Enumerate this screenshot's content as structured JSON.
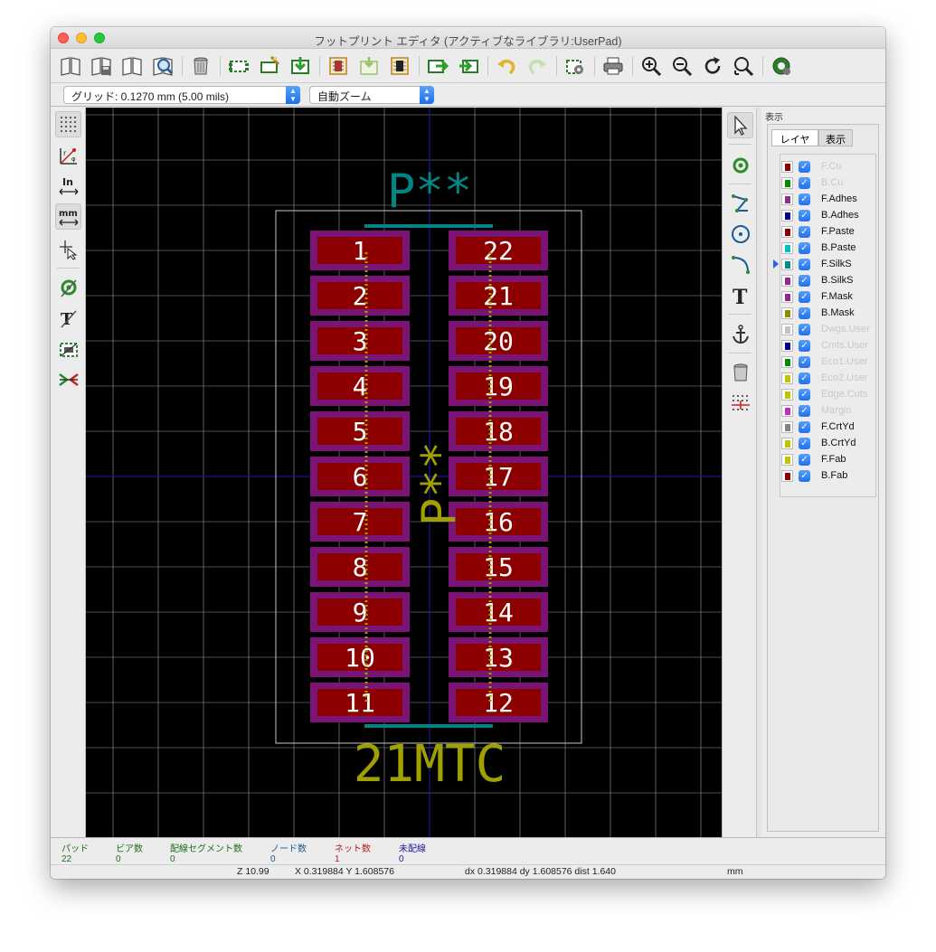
{
  "window": {
    "title": "フットプリント エディタ (アクティブなライブラリ:UserPad)"
  },
  "selects": {
    "grid": "グリッド: 0.1270 mm (5.00 mils)",
    "zoom": "自動ズーム"
  },
  "left_units": {
    "inch_label": "In",
    "mm_label": "mm"
  },
  "canvas": {
    "reference": "P**",
    "reference_rotated": "P**",
    "value": "21MTC",
    "pads_left": [
      "1",
      "2",
      "3",
      "4",
      "5",
      "6",
      "7",
      "8",
      "9",
      "10",
      "11"
    ],
    "pads_right": [
      "22",
      "21",
      "20",
      "19",
      "18",
      "17",
      "16",
      "15",
      "14",
      "13",
      "12"
    ],
    "colors": {
      "pad": "#8c0000",
      "mask": "#7c1478",
      "silk": "#008484",
      "fab": "#a0a000",
      "grid": "#9a9a9a",
      "axis": "#1c1ca8",
      "crtyd": "#c8c8c8"
    }
  },
  "layers_panel": {
    "title": "表示",
    "tabs": [
      "レイヤ",
      "表示"
    ],
    "layers": [
      {
        "name": "F.Cu",
        "color": "#8c0000",
        "enabled": false
      },
      {
        "name": "B.Cu",
        "color": "#008c00",
        "enabled": false
      },
      {
        "name": "F.Adhes",
        "color": "#8c2c8c",
        "enabled": true
      },
      {
        "name": "B.Adhes",
        "color": "#00008c",
        "enabled": true
      },
      {
        "name": "F.Paste",
        "color": "#8c0000",
        "enabled": true
      },
      {
        "name": "B.Paste",
        "color": "#00c2c2",
        "enabled": true
      },
      {
        "name": "F.SilkS",
        "color": "#008c8c",
        "enabled": true
      },
      {
        "name": "B.SilkS",
        "color": "#8c2c8c",
        "enabled": true
      },
      {
        "name": "F.Mask",
        "color": "#8c2c8c",
        "enabled": true
      },
      {
        "name": "B.Mask",
        "color": "#8c8c00",
        "enabled": true
      },
      {
        "name": "Dwgs.User",
        "color": "#c2c2c2",
        "enabled": false
      },
      {
        "name": "Cmts.User",
        "color": "#00008c",
        "enabled": false
      },
      {
        "name": "Eco1.User",
        "color": "#008c00",
        "enabled": false
      },
      {
        "name": "Eco2.User",
        "color": "#c2c200",
        "enabled": false
      },
      {
        "name": "Edge.Cuts",
        "color": "#c2c200",
        "enabled": false
      },
      {
        "name": "Margin",
        "color": "#c22cc2",
        "enabled": false
      },
      {
        "name": "F.CrtYd",
        "color": "#848484",
        "enabled": true
      },
      {
        "name": "B.CrtYd",
        "color": "#c2c200",
        "enabled": true
      },
      {
        "name": "F.Fab",
        "color": "#c2c200",
        "enabled": true
      },
      {
        "name": "B.Fab",
        "color": "#8c0000",
        "enabled": true
      }
    ]
  },
  "message_panel": [
    {
      "label": "パッド",
      "value": "22",
      "color": "#1e6e1e"
    },
    {
      "label": "ビア数",
      "value": "0",
      "color": "#1e6e1e"
    },
    {
      "label": "配線セグメント数",
      "value": "0",
      "color": "#1e6e1e"
    },
    {
      "label": "ノード数",
      "value": "0",
      "color": "#1c5a8c"
    },
    {
      "label": "ネット数",
      "value": "1",
      "color": "#b41e1e"
    },
    {
      "label": "未配線",
      "value": "0",
      "color": "#1c1c9c"
    }
  ],
  "status": {
    "zoom": "Z 10.99",
    "xy": "X 0.319884  Y 1.608576",
    "delta": "dx 0.319884  dy 1.608576  dist 1.640",
    "units": "mm"
  }
}
